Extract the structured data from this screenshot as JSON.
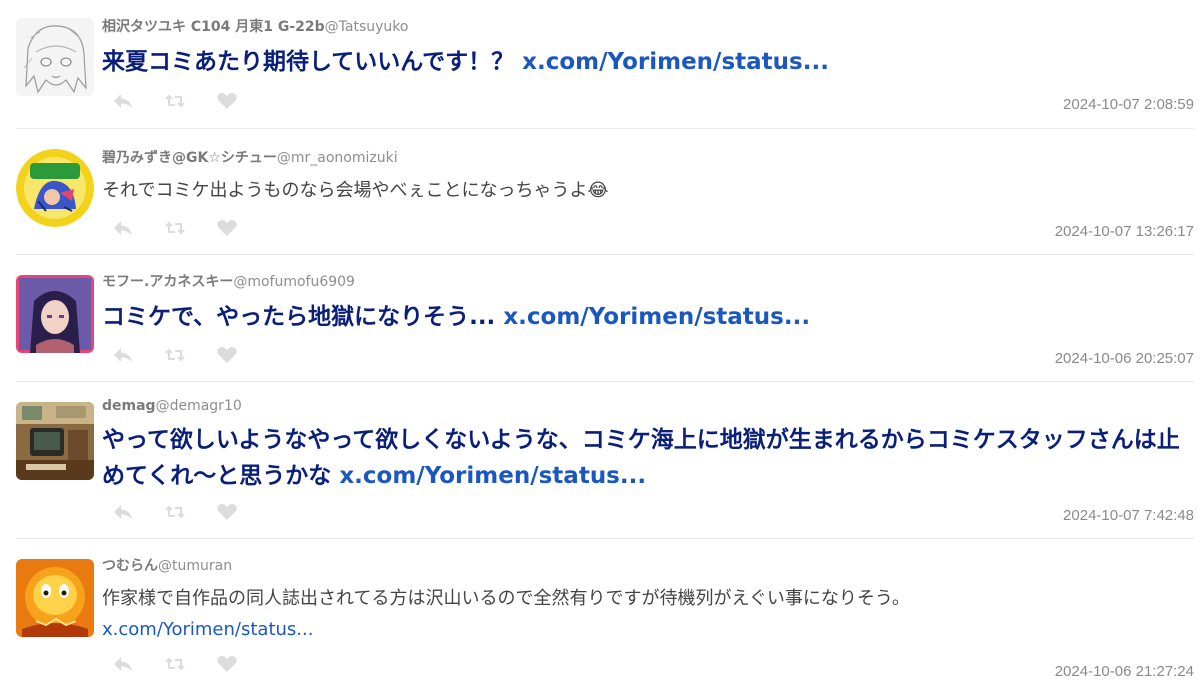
{
  "tweets": [
    {
      "name": "相沢タツユキ C104 月東1 G-22b",
      "handle": "@Tatsuyuko",
      "text": "来夏コミあたり期待していいんです！？ ",
      "link": "x.com/Yorimen/status...",
      "timestamp": "2024-10-07 2:08:59",
      "style": "big"
    },
    {
      "name": "碧乃みずき@GK☆シチュー",
      "handle": "@mr_aonomizuki",
      "text": "それでコミケ出ようものなら会場やべぇことになっちゃうよ😂",
      "link": "",
      "timestamp": "2024-10-07 13:26:17",
      "style": "normal"
    },
    {
      "name": "モフー.アカネスキー",
      "handle": "@mofumofu6909",
      "text": "コミケで、やったら地獄になりそう... ",
      "link": "x.com/Yorimen/status...",
      "timestamp": "2024-10-06 20:25:07",
      "style": "big"
    },
    {
      "name": "demag",
      "handle": "@demagr10",
      "text": "やって欲しいようなやって欲しくないような、コミケ海上に地獄が生まれるからコミケスタッフさんは止めてくれ〜と思うかな ",
      "link": "x.com/Yorimen/status...",
      "timestamp": "2024-10-07 7:42:48",
      "style": "big"
    },
    {
      "name": "つむらん",
      "handle": "@tumuran",
      "text": "作家様で自作品の同人誌出されてる方は沢山いるので全然有りですが待機列がえぐい事になりそう。\n",
      "link": "x.com/Yorimen/status...",
      "timestamp": "2024-10-06 21:27:24",
      "style": "normal"
    }
  ],
  "icons": [
    "reply-icon",
    "retweet-icon",
    "like-icon"
  ],
  "colors": {
    "big_text": "#0a1f7a",
    "link": "#1a58c0",
    "username": "#7a7a7a",
    "timestamp": "#8a8a8a",
    "icon": "#dcdcdc",
    "divider": "#e8e8e8"
  }
}
